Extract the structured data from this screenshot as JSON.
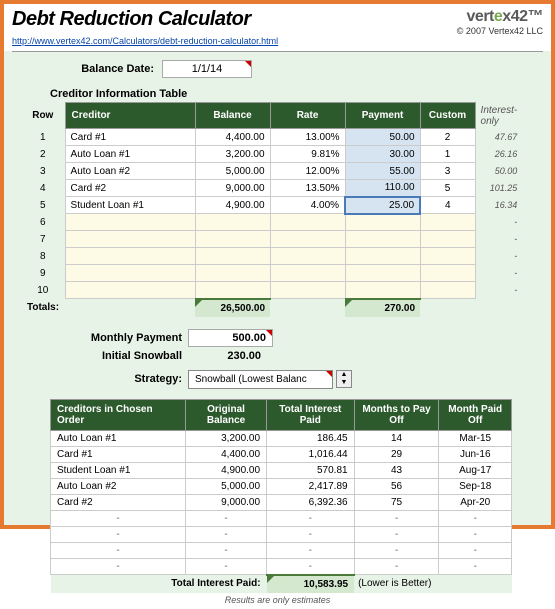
{
  "header": {
    "title": "Debt Reduction Calculator",
    "link": "http://www.vertex42.com/Calculators/debt-reduction-calculator.html",
    "logo_pre": "vert",
    "logo_x": "e",
    "logo_post": "x42",
    "copyright": "© 2007 Vertex42 LLC"
  },
  "balance_date": {
    "label": "Balance Date:",
    "value": "1/1/14"
  },
  "table1": {
    "title": "Creditor Information Table",
    "rowlbl": "Row",
    "headers": [
      "Creditor",
      "Balance",
      "Rate",
      "Payment",
      "Custom"
    ],
    "io_header": "Interest-only",
    "rows": [
      {
        "n": "1",
        "creditor": "Card #1",
        "balance": "4,400.00",
        "rate": "13.00%",
        "payment": "50.00",
        "custom": "2",
        "io": "47.67",
        "sel": false
      },
      {
        "n": "2",
        "creditor": "Auto Loan #1",
        "balance": "3,200.00",
        "rate": "9.81%",
        "payment": "30.00",
        "custom": "1",
        "io": "26.16",
        "sel": false
      },
      {
        "n": "3",
        "creditor": "Auto Loan #2",
        "balance": "5,000.00",
        "rate": "12.00%",
        "payment": "55.00",
        "custom": "3",
        "io": "50.00",
        "sel": false
      },
      {
        "n": "4",
        "creditor": "Card #2",
        "balance": "9,000.00",
        "rate": "13.50%",
        "payment": "110.00",
        "custom": "5",
        "io": "101.25",
        "sel": false
      },
      {
        "n": "5",
        "creditor": "Student Loan #1",
        "balance": "4,900.00",
        "rate": "4.00%",
        "payment": "25.00",
        "custom": "4",
        "io": "16.34",
        "sel": true
      }
    ],
    "empty": [
      "6",
      "7",
      "8",
      "9",
      "10"
    ],
    "totals_label": "Totals:",
    "total_balance": "26,500.00",
    "total_payment": "270.00"
  },
  "monthly": {
    "label": "Monthly Payment",
    "value": "500.00"
  },
  "snowball": {
    "label": "Initial Snowball",
    "value": "230.00"
  },
  "strategy": {
    "label": "Strategy:",
    "value": "Snowball (Lowest Balanc"
  },
  "table2": {
    "headers": [
      "Creditors in Chosen Order",
      "Original Balance",
      "Total Interest Paid",
      "Months to Pay Off",
      "Month Paid Off"
    ],
    "rows": [
      {
        "c": "Auto Loan #1",
        "b": "3,200.00",
        "i": "186.45",
        "m": "14",
        "p": "Mar-15"
      },
      {
        "c": "Card #1",
        "b": "4,400.00",
        "i": "1,016.44",
        "m": "29",
        "p": "Jun-16"
      },
      {
        "c": "Student Loan #1",
        "b": "4,900.00",
        "i": "570.81",
        "m": "43",
        "p": "Aug-17"
      },
      {
        "c": "Auto Loan #2",
        "b": "5,000.00",
        "i": "2,417.89",
        "m": "56",
        "p": "Sep-18"
      },
      {
        "c": "Card #2",
        "b": "9,000.00",
        "i": "6,392.36",
        "m": "75",
        "p": "Apr-20"
      }
    ],
    "empty_count": 4,
    "tip_label": "Total Interest Paid:",
    "tip_value": "10,583.95",
    "tip_note": "(Lower is Better)"
  },
  "footer": "Results are only estimates"
}
